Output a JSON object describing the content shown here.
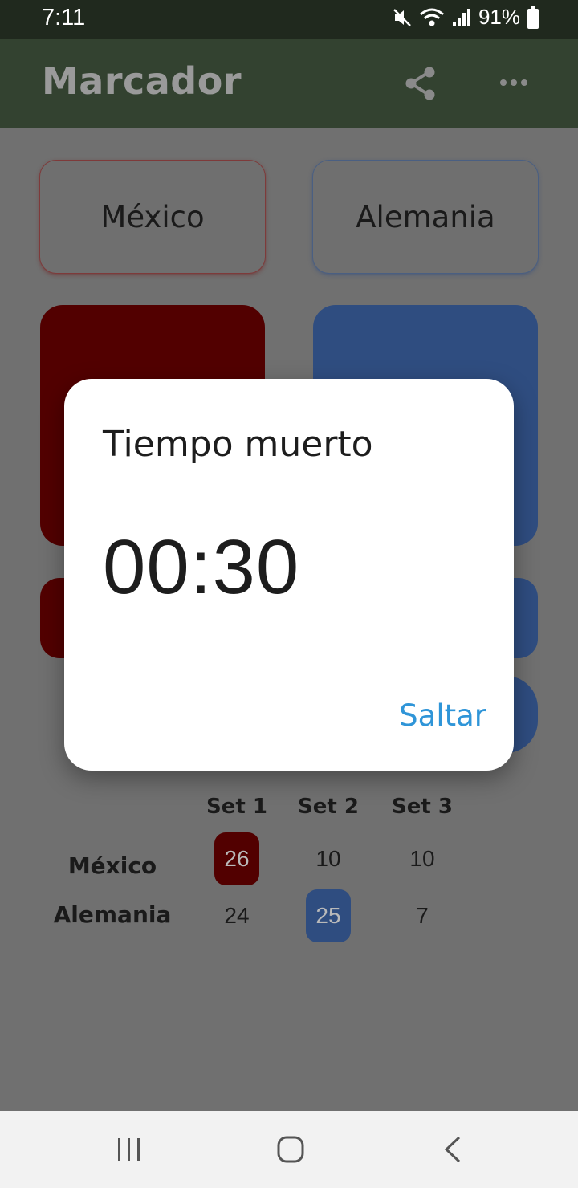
{
  "status_bar": {
    "time": "7:11",
    "battery": "91%",
    "icons": [
      "mute-icon",
      "wifi-icon",
      "signal-icon",
      "battery-icon"
    ]
  },
  "app_bar": {
    "title": "Marcador",
    "actions": [
      "share-icon",
      "more-icon"
    ]
  },
  "teams": {
    "home": "México",
    "away": "Alemania"
  },
  "colors": {
    "home": "#520000",
    "away": "#2f4d80",
    "app_bar": "#334230",
    "dialog_action": "#2f95d8"
  },
  "sets_table": {
    "headers": [
      "Set 1",
      "Set 2",
      "Set 3"
    ],
    "rows": [
      {
        "team": "México",
        "scores": [
          "26",
          "10",
          "10"
        ],
        "highlight": [
          true,
          false,
          false
        ]
      },
      {
        "team": "Alemania",
        "scores": [
          "24",
          "25",
          "7"
        ],
        "highlight": [
          false,
          true,
          false
        ]
      }
    ]
  },
  "dialog": {
    "title": "Tiempo muerto",
    "timer": "00:30",
    "action": "Saltar"
  }
}
